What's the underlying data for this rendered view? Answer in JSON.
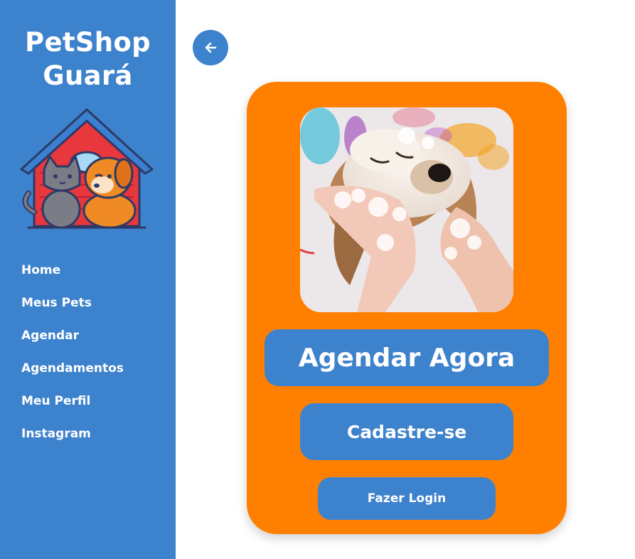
{
  "sidebar": {
    "brand_line1": "PetShop",
    "brand_line2": "Guará",
    "nav": [
      {
        "label": "Home"
      },
      {
        "label": "Meus Pets"
      },
      {
        "label": "Agendar"
      },
      {
        "label": "Agendamentos"
      },
      {
        "label": "Meu Perfil"
      },
      {
        "label": "Instagram"
      }
    ]
  },
  "back_button": {
    "icon": "arrow-left-icon"
  },
  "card": {
    "image": "dog-bath-photo",
    "primary_label": "Agendar Agora",
    "secondary_label": "Cadastre-se",
    "tertiary_label": "Fazer Login"
  },
  "colors": {
    "sidebar": "#3d82cc",
    "card": "#ff8000",
    "button": "#3d82cc",
    "text_on_color": "#ffffff"
  }
}
